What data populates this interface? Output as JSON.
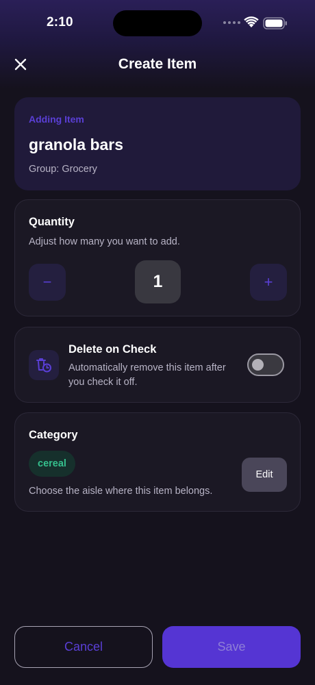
{
  "status_bar": {
    "time": "2:10"
  },
  "nav": {
    "title": "Create Item",
    "close_icon": "close-icon"
  },
  "hero": {
    "eyebrow": "Adding Item",
    "item_name": "granola bars",
    "group_line": "Group: Grocery"
  },
  "quantity": {
    "title": "Quantity",
    "description": "Adjust how many you want to add.",
    "value": "1",
    "decrement_label": "−",
    "increment_label": "+"
  },
  "delete_on_check": {
    "title": "Delete on Check",
    "description": "Automatically remove this item after you check it off.",
    "enabled": false,
    "icon": "trash-timer-icon"
  },
  "category": {
    "title": "Category",
    "selected": "cereal",
    "description": "Choose the aisle where this item belongs.",
    "edit_label": "Edit"
  },
  "actions": {
    "cancel_label": "Cancel",
    "save_label": "Save"
  },
  "colors": {
    "accent": "#5535d3",
    "background": "#15121d",
    "chip_text": "#35c08d"
  }
}
